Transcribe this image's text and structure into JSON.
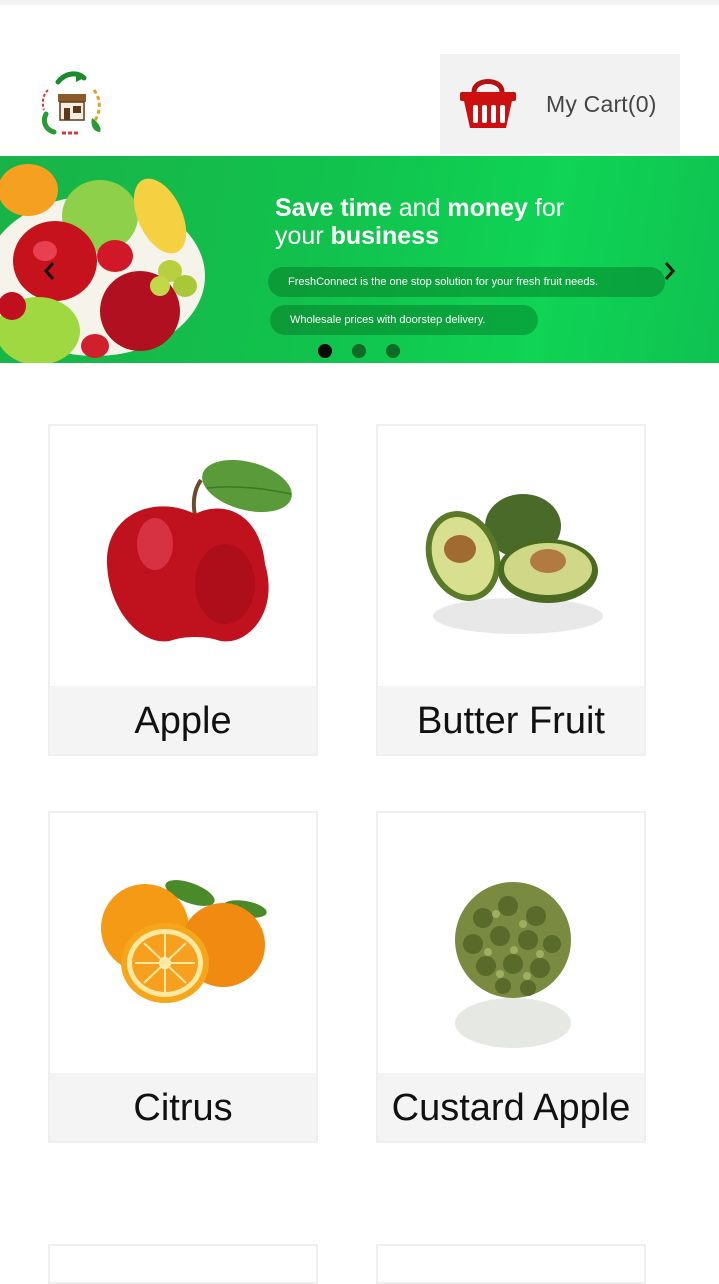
{
  "header": {
    "cart_label": "My Cart(0)",
    "logo_icon": "store-recycle-logo-icon",
    "cart_icon": "basket-icon"
  },
  "banner": {
    "headline": {
      "part1": "Save time",
      "part2": " and ",
      "part3": "money",
      "part4": " for",
      "part5": "your ",
      "part6": "business"
    },
    "tagline1": "FreshConnect is the one stop solution for your fresh fruit needs.",
    "tagline2": "Wholesale prices with doorstep delivery.",
    "slides": 3,
    "active_slide": 1,
    "colors": {
      "background": "#11c24d",
      "dot_active": "#0a0a0a",
      "dot_inactive": "#0f6a27"
    }
  },
  "products": [
    {
      "name": "Apple",
      "icon": "apple-icon"
    },
    {
      "name": "Butter Fruit",
      "icon": "avocado-icon"
    },
    {
      "name": "Citrus",
      "icon": "orange-icon"
    },
    {
      "name": "Custard Apple",
      "icon": "custard-apple-icon"
    }
  ],
  "colors": {
    "cart_red": "#cc1010",
    "card_caption_bg": "#f4f4f4"
  }
}
